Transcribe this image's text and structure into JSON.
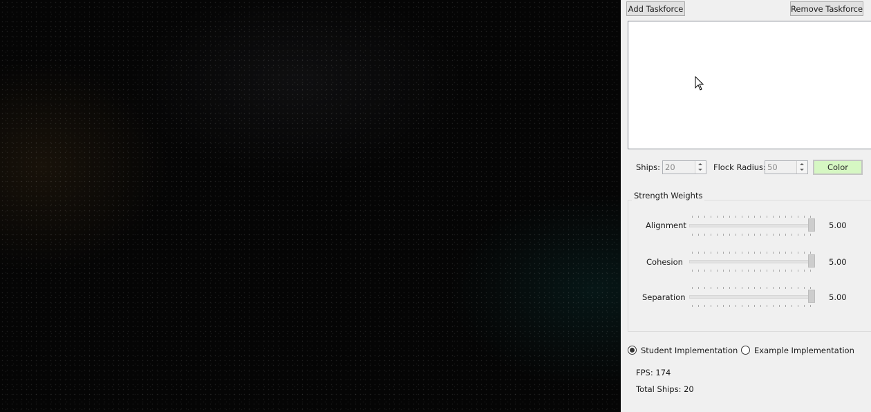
{
  "taskforce": {
    "add_label": "Add Taskforce",
    "remove_label": "Remove Taskforce"
  },
  "settings": {
    "ships_label": "Ships:",
    "ships_value": "20",
    "flock_radius_label": "Flock Radius:",
    "flock_radius_value": "50",
    "color_label": "Color",
    "color_value": "#d6f7c3"
  },
  "weights": {
    "title": "Strength Weights",
    "max": 5,
    "items": [
      {
        "label": "Alignment",
        "value": 5,
        "display": "5.00"
      },
      {
        "label": "Cohesion",
        "value": 5,
        "display": "5.00"
      },
      {
        "label": "Separation",
        "value": 5,
        "display": "5.00"
      }
    ]
  },
  "implementation": {
    "student_label": "Student Implementation",
    "example_label": "Example Implementation",
    "selected": "student"
  },
  "stats": {
    "fps": "FPS: 174",
    "total_ships": "Total Ships: 20"
  }
}
